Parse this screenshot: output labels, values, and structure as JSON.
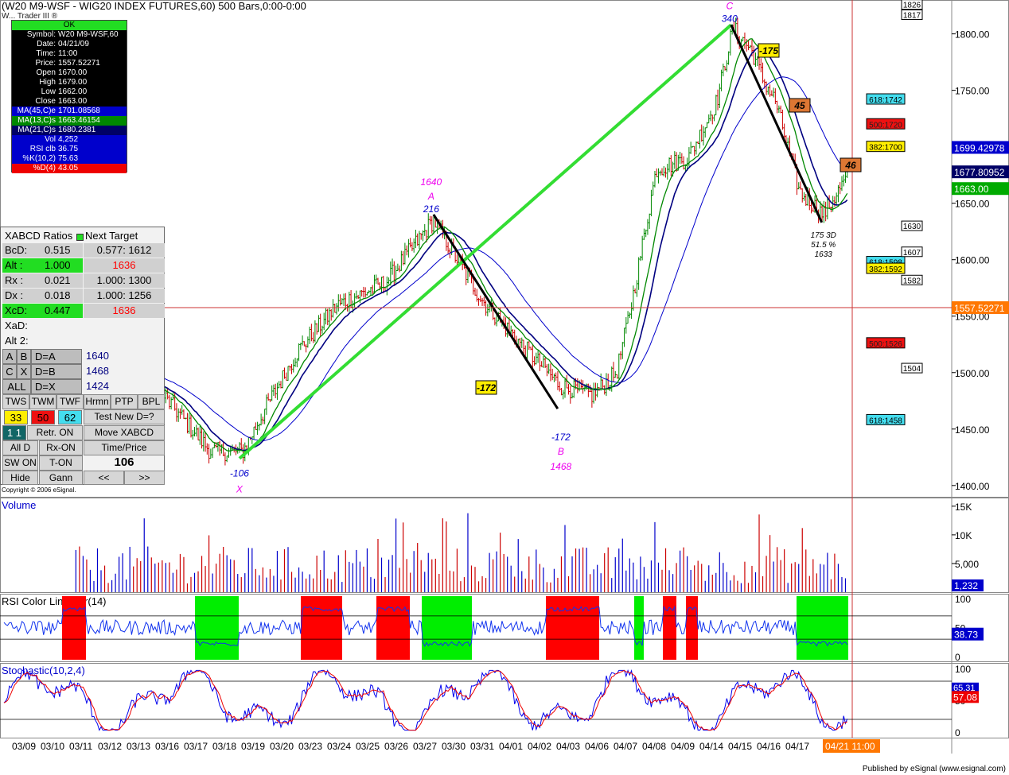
{
  "header": {
    "title": "(W20 M9-WSF - WIG20 INDEX FUTURES,60) 500 Bars,0:00-0:00",
    "subtitle": "W... Trader III ®"
  },
  "data_window": {
    "status": "OK",
    "rows": [
      {
        "label": "Symbol:",
        "value": "W20 M9-WSF,60",
        "bg": "#000000",
        "fg": "#ffffff"
      },
      {
        "label": "Date:",
        "value": "04/21/09",
        "bg": "#000000",
        "fg": "#ffffff"
      },
      {
        "label": "Time:",
        "value": "11:00",
        "bg": "#000000",
        "fg": "#ffffff"
      },
      {
        "label": "Price:",
        "value": "1557.52271",
        "bg": "#000000",
        "fg": "#ffffff"
      },
      {
        "label": "Open",
        "value": "1670.00",
        "bg": "#000000",
        "fg": "#ffffff"
      },
      {
        "label": "High",
        "value": "1679.00",
        "bg": "#000000",
        "fg": "#ffffff"
      },
      {
        "label": "Low",
        "value": "1662.00",
        "bg": "#000000",
        "fg": "#ffffff"
      },
      {
        "label": "Close",
        "value": "1663.00",
        "bg": "#000000",
        "fg": "#ffffff"
      },
      {
        "label": "MA(45,C)e",
        "value": "1701.08568",
        "bg": "#0000cc",
        "fg": "#ffffff"
      },
      {
        "label": "MA(13,C)s",
        "value": "1663.46154",
        "bg": "#008800",
        "fg": "#ffffff"
      },
      {
        "label": "MA(21,C)s",
        "value": "1680.2381",
        "bg": "#000066",
        "fg": "#ffffff"
      },
      {
        "label": "Vol",
        "value": "4,252",
        "bg": "#0000cc",
        "fg": "#ffffff"
      },
      {
        "label": "RSI clb",
        "value": "36.75",
        "bg": "#0000cc",
        "fg": "#ffffff"
      },
      {
        "label": "%K(10,2)",
        "value": "75.63",
        "bg": "#0000cc",
        "fg": "#ffffff"
      },
      {
        "label": "%D(4)",
        "value": "43.05",
        "bg": "#ee0000",
        "fg": "#ffffff"
      }
    ]
  },
  "xabcd_panel": {
    "title": "XABCD Ratios",
    "next_target": "Next Target",
    "rows": [
      {
        "label": "BcD:",
        "value": "0.515",
        "target": "0.577: 1612",
        "bg": "#d0d0d0",
        "tcolor": "#000000"
      },
      {
        "label": "Alt   :",
        "value": "1.000",
        "target": "1636",
        "bg": "#22dd22",
        "tcolor": "#ff0000"
      },
      {
        "label": "Rx    :",
        "value": "0.021",
        "target": "1.000: 1300",
        "bg": "#d0d0d0",
        "tcolor": "#000000"
      },
      {
        "label": "Dx    :",
        "value": "0.018",
        "target": "1.000: 1256",
        "bg": "#d0d0d0",
        "tcolor": "#000000"
      },
      {
        "label": "XcD:",
        "value": "0.447",
        "target": "1636",
        "bg": "#22dd22",
        "tcolor": "#ff0000"
      }
    ],
    "xad_label": "XaD:",
    "alt2_label": "Alt 2:",
    "d_rows": [
      {
        "a": "A",
        "b": "B",
        "label": "D=A",
        "value": "1640"
      },
      {
        "a": "C",
        "b": "X",
        "label": "D=B",
        "value": "1468"
      },
      {
        "a": "ALL",
        "b": "",
        "label": "D=X",
        "value": "1424"
      }
    ],
    "tabs": [
      "TWS",
      "TWM",
      "TWF",
      "Hrmn",
      "PTP",
      "BPL"
    ],
    "chips": [
      {
        "text": "33",
        "bg": "#ffee00"
      },
      {
        "text": "50",
        "bg": "#ee1111"
      },
      {
        "text": "62",
        "bg": "#44ddee"
      }
    ],
    "test_new": "Test New D=?",
    "retr": "Retr. ON",
    "move": "Move XABCD",
    "all_label": "All D",
    "rx_on": "Rx-ON",
    "time_price": "Time/Price",
    "sw_on": "SW ON",
    "t_on": "T-ON",
    "count": "106",
    "hide": "Hide",
    "gann": "Gann",
    "prev": "<<",
    "next": ">>",
    "one_one": "1 1"
  },
  "copyright": "Copyright © 2006 eSignal.",
  "footer": "Published by eSignal (www.esignal.com)",
  "colors": {
    "up_bar": "#008800",
    "down_bar": "#cc0000",
    "ma13": "#008800",
    "ma21": "#000080",
    "ma45": "#0000cc",
    "trend": "#33dd33",
    "rsi_hi": "#ff0000",
    "rsi_lo": "#00ee00",
    "stoch_k": "#0000ee",
    "stoch_d": "#ee0000"
  },
  "chart_data": {
    "type": "candlestick",
    "symbol": "W20 M9-WSF",
    "interval": "60",
    "x_ticks": [
      "03/09",
      "03/10",
      "03/11",
      "03/12",
      "03/13",
      "03/16",
      "03/17",
      "03/18",
      "03/19",
      "03/20",
      "03/23",
      "03/24",
      "03/25",
      "03/26",
      "03/27",
      "03/30",
      "03/31",
      "04/01",
      "04/02",
      "04/03",
      "04/06",
      "04/07",
      "04/08",
      "04/09",
      "04/14",
      "04/15",
      "04/16",
      "04/17",
      "04/21 11:00"
    ],
    "price_axis": {
      "ticks": [
        "1800.00",
        "1750.00",
        "1700.00",
        "1650.00",
        "1600.00",
        "1550.00",
        "1500.00",
        "1450.00",
        "1400.00"
      ],
      "range": [
        1390,
        1830
      ]
    },
    "last_price_labels": [
      {
        "text": "1699.42978",
        "value": 1699.43,
        "bg": "#0000cc"
      },
      {
        "text": "1677.80952",
        "value": 1677.81,
        "bg": "#000066"
      },
      {
        "text": "1663.00",
        "value": 1663.0,
        "bg": "#00aa00"
      },
      {
        "text": "1557.52271",
        "value": 1557.52,
        "bg": "#ff7700"
      }
    ],
    "key_points": [
      {
        "date": "03/18",
        "price": 1424,
        "label": "X",
        "bars": "-106"
      },
      {
        "date": "03/26",
        "price": 1640,
        "label": "A",
        "bars": "216"
      },
      {
        "date": "03/31",
        "price": 1468,
        "label": "B",
        "bars": "-172"
      },
      {
        "date": "04/14",
        "price": 1808,
        "label": "C",
        "bars": "340"
      },
      {
        "date": "04/20",
        "price": 1633,
        "label": "D",
        "bars": "175"
      }
    ],
    "pattern_labels": {
      "a_price": "1640",
      "a": "A",
      "a_bars": "216",
      "x": "X",
      "x_bars": "-106",
      "b": "B",
      "b_bars": "-172",
      "b_price": "1468",
      "c": "C",
      "c_bars": "340",
      "d_bars": "175 3D",
      "d_ratio": "51.5 %",
      "d_price": "1633",
      "box_172": "-172",
      "box_175": "-175",
      "box_45": "45",
      "box_46": "46"
    },
    "fib_levels": [
      {
        "text": "618:1742",
        "value": 1742,
        "bg": "#44ddee",
        "fg": "#000000"
      },
      {
        "text": "500:1720",
        "value": 1720,
        "bg": "#ee1111",
        "fg": "#222222"
      },
      {
        "text": "382:1700",
        "value": 1700,
        "bg": "#ffee00",
        "fg": "#000000"
      },
      {
        "text": "618:1598",
        "value": 1598,
        "bg": "#44ddee",
        "fg": "#000000"
      },
      {
        "text": "382:1592",
        "value": 1592,
        "bg": "#ffee00",
        "fg": "#000000"
      },
      {
        "text": "500:1526",
        "value": 1526,
        "bg": "#ee1111",
        "fg": "#222222"
      },
      {
        "text": "618:1458",
        "value": 1458,
        "bg": "#44ddee",
        "fg": "#000000"
      }
    ],
    "target_boxes": [
      {
        "text": "1826",
        "value": 1826
      },
      {
        "text": "1817",
        "value": 1817
      },
      {
        "text": "1630",
        "value": 1630
      },
      {
        "text": "1607",
        "value": 1607
      },
      {
        "text": "1582",
        "value": 1582
      },
      {
        "text": "1504",
        "value": 1504
      }
    ],
    "volume": {
      "title": "Volume",
      "ticks": [
        "15K",
        "10K",
        "5,000"
      ],
      "tick_values": [
        15000,
        10000,
        5000
      ],
      "last": "1,232",
      "range": [
        0,
        16500
      ]
    },
    "rsi": {
      "title": "RSI Color Line Bar(14)",
      "ticks": [
        "100",
        "50",
        "0"
      ],
      "last": "38.73",
      "upper": 70,
      "lower": 30
    },
    "stochastic": {
      "title": "Stochastic(10,2,4)",
      "ticks": [
        "100",
        "50",
        "0"
      ],
      "last_k": "65.31",
      "last_d": "57.08"
    }
  }
}
